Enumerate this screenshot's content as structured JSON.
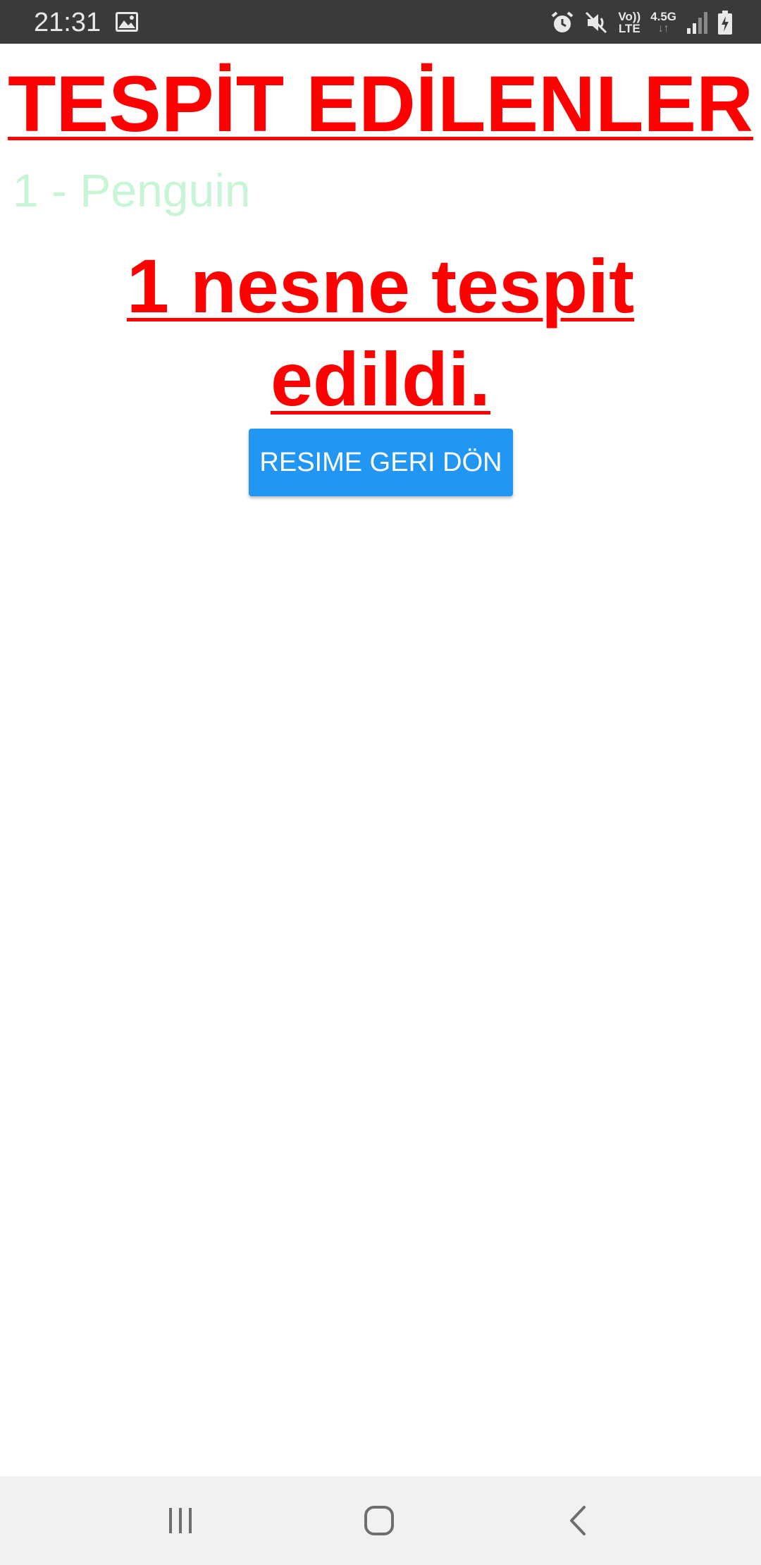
{
  "status_bar": {
    "time": "21:31",
    "gallery_icon": "image-icon",
    "icons": [
      "alarm-icon",
      "mute-icon",
      "volte-icon",
      "network-4.5g-icon",
      "signal-icon",
      "battery-charging-icon"
    ],
    "volte_top": "Vo))",
    "volte_bottom": "LTE",
    "network_label": "4.5G"
  },
  "main": {
    "title": "TESPİT EDİLENLER",
    "detected_items": [
      "1 - Penguin"
    ],
    "summary": "1 nesne tespit edildi.",
    "back_button_label": "RESIME GERI DÖN"
  },
  "nav_bar": {
    "icons": [
      "recent-apps-icon",
      "home-icon",
      "back-icon"
    ]
  },
  "colors": {
    "title": "#ff0000",
    "item": "#c8f5d6",
    "button": "#2196f3",
    "status_bar": "#3a3a3a",
    "nav_bar": "#f1f1f1"
  }
}
